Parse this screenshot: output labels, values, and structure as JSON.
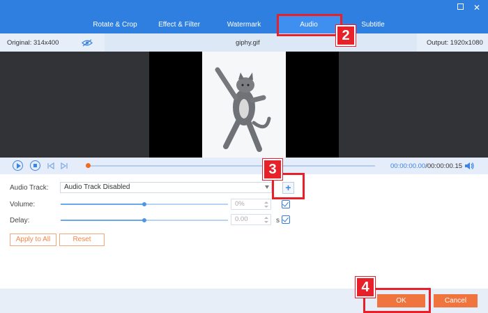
{
  "tabs": [
    {
      "label": "Rotate & Crop"
    },
    {
      "label": "Effect & Filter"
    },
    {
      "label": "Watermark"
    },
    {
      "label": "Audio"
    },
    {
      "label": "Subtitle"
    }
  ],
  "info": {
    "original": "Original: 314x400",
    "filename": "giphy.gif",
    "output": "Output: 1920x1080"
  },
  "playback": {
    "current_time": "00:00:00.00",
    "total_time": "/00:00:00.15",
    "progress": 0
  },
  "audio": {
    "track_label": "Audio Track:",
    "track_value": "Audio Track Disabled",
    "add_symbol": "+",
    "volume_label": "Volume:",
    "volume_value": "0%",
    "volume_level": 0.5,
    "delay_label": "Delay:",
    "delay_value": "0.00",
    "delay_level": 0.5,
    "delay_unit": "s"
  },
  "buttons": {
    "apply_all": "Apply to All",
    "reset": "Reset",
    "ok": "OK",
    "cancel": "Cancel"
  },
  "annotations": {
    "step2": "2",
    "step3": "3",
    "step4": "4",
    "color": "#e8202a"
  },
  "colors": {
    "accent": "#2e7fe0",
    "button": "#f0743e"
  }
}
